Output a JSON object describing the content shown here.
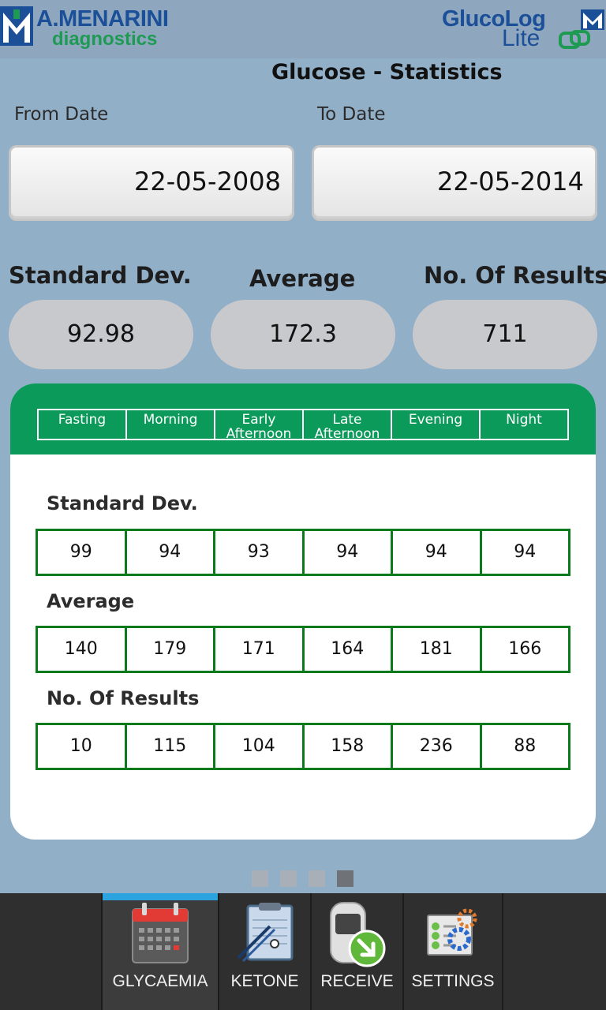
{
  "header": {
    "brand_left": "A.MENARINI",
    "brand_left_sub": "diagnostics",
    "brand_right": "GlucoLog",
    "brand_right_sub": "Lite"
  },
  "page": {
    "title": "Glucose - Statistics"
  },
  "dates": {
    "from_label": "From Date",
    "from_value": "22-05-2008",
    "to_label": "To Date",
    "to_value": "22-05-2014"
  },
  "summary": {
    "std_label": "Standard Dev.",
    "std_value": "92.98",
    "avg_label": "Average",
    "avg_value": "172.3",
    "count_label": "No. Of Results",
    "count_value": "711"
  },
  "table": {
    "columns": [
      {
        "line1": "Fasting",
        "line2": ""
      },
      {
        "line1": "Morning",
        "line2": ""
      },
      {
        "line1": "Early",
        "line2": "Afternoon"
      },
      {
        "line1": "Late",
        "line2": "Afternoon"
      },
      {
        "line1": "Evening",
        "line2": ""
      },
      {
        "line1": "Night",
        "line2": ""
      }
    ],
    "std_title": "Standard Dev.",
    "std_values": [
      "99",
      "94",
      "93",
      "94",
      "94",
      "94"
    ],
    "avg_title": "Average",
    "avg_values": [
      "140",
      "179",
      "171",
      "164",
      "181",
      "166"
    ],
    "count_title": "No. Of Results",
    "count_values": [
      "10",
      "115",
      "104",
      "158",
      "236",
      "88"
    ]
  },
  "pager": {
    "pages": 4,
    "active_index": 3
  },
  "nav": {
    "items": [
      {
        "label": "GLYCAEMIA",
        "icon": "calendar-icon",
        "active": true
      },
      {
        "label": "KETONE",
        "icon": "clipboard-icon",
        "active": false
      },
      {
        "label": "RECEIVE",
        "icon": "meter-download-icon",
        "active": false
      },
      {
        "label": "SETTINGS",
        "icon": "settings-gear-icon",
        "active": false
      }
    ]
  },
  "colors": {
    "background": "#92afc8",
    "card_header": "#0b9a5a",
    "cell_border": "#0a7a1c",
    "nav_active_indicator": "#2aa3de"
  }
}
